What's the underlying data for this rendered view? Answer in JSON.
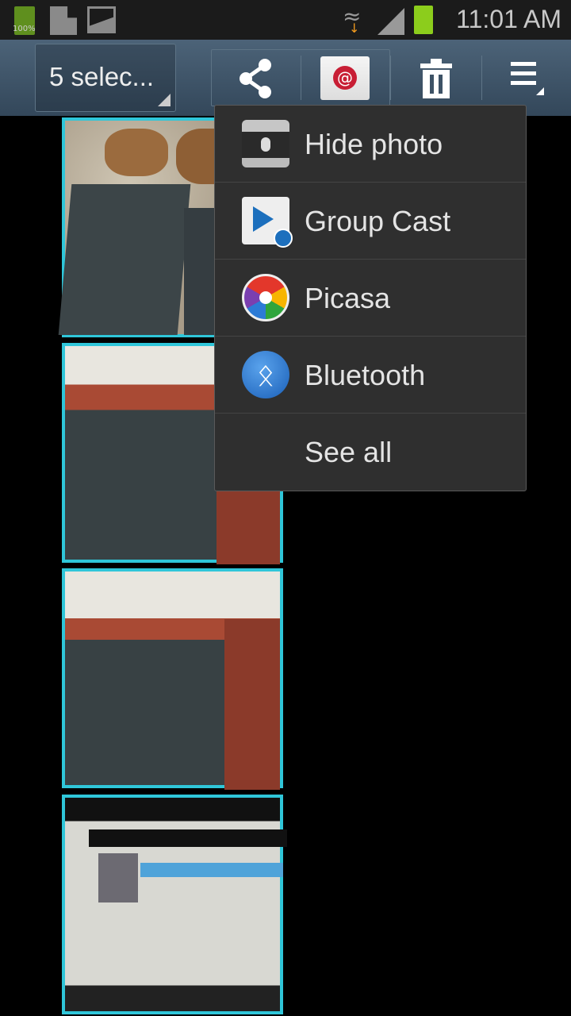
{
  "status_bar": {
    "battery_small_label": "100%",
    "time": "11:01 AM"
  },
  "action_bar": {
    "selection_label": "5 selec...",
    "icons": [
      "share-icon",
      "email-icon",
      "trash-icon",
      "overflow-menu-icon"
    ]
  },
  "share_menu": {
    "items": [
      {
        "label": "Hide photo",
        "icon": "hide-photo-icon"
      },
      {
        "label": "Group Cast",
        "icon": "group-cast-icon"
      },
      {
        "label": "Picasa",
        "icon": "picasa-icon"
      },
      {
        "label": "Bluetooth",
        "icon": "bluetooth-icon"
      },
      {
        "label": "See all"
      }
    ]
  },
  "photos": {
    "selected_border_color": "#2fc6d9",
    "count_visible": 4
  },
  "colors": {
    "menu_bg": "#2f2f2f",
    "action_bar": "#4c6378"
  }
}
